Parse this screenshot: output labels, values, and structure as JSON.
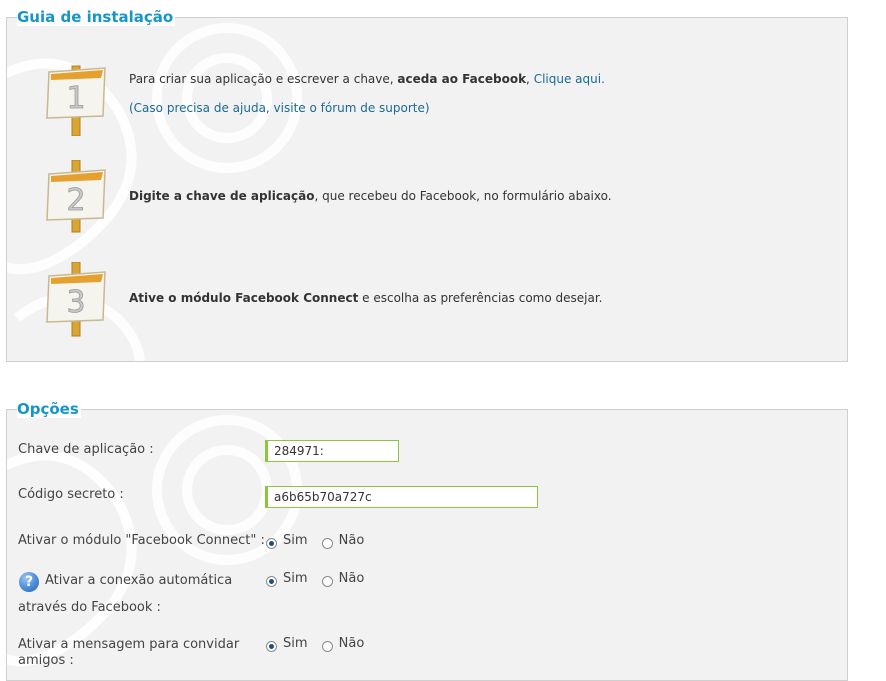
{
  "guide": {
    "legend": "Guia de instalação",
    "steps": [
      {
        "number": "1",
        "text_before": "Para criar sua aplicação e escrever a chave, ",
        "bold": "aceda ao Facebook",
        "text_after": ", ",
        "link": "Clique aqui.",
        "help_link": "(Caso precisa de ajuda, visite o fórum de suporte)"
      },
      {
        "number": "2",
        "bold": "Digite a chave de aplicação",
        "text_after": ", que recebeu do Facebook, no formulário abaixo."
      },
      {
        "number": "3",
        "bold": "Ative o módulo Facebook Connect",
        "text_after": " e escolha as preferências como desejar."
      }
    ]
  },
  "options": {
    "legend": "Opções",
    "app_key": {
      "label": "Chave de aplicação :",
      "value": "284971:"
    },
    "secret_code": {
      "label": "Código secreto :",
      "value": "a6b65b70a727c"
    },
    "enable_module": {
      "label": "Ativar o módulo \"Facebook Connect\" :",
      "yes": "Sim",
      "no": "Não",
      "selected": "Sim"
    },
    "auto_connect": {
      "label_line1": "Ativar a conexão automática",
      "label_line2": "através do Facebook :",
      "yes": "Sim",
      "no": "Não",
      "selected": "Sim",
      "icon": "help-icon",
      "icon_glyph": "?"
    },
    "invite_message": {
      "label_line1": "Ativar a mensagem para convidar",
      "label_line2": "amigos :",
      "yes": "Sim",
      "no": "Não",
      "selected": "Sim"
    }
  },
  "colors": {
    "accent": "#1596c8",
    "link": "#1a6a95",
    "input_border": "#8cc63f",
    "panel_bg": "#f2f2f2"
  }
}
